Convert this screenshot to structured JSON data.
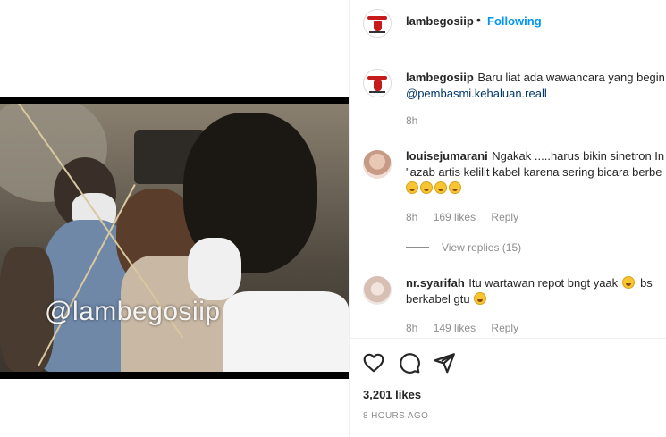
{
  "video": {
    "watermark": "@lambegosiip"
  },
  "header": {
    "username": "lambegosiip",
    "separator": "•",
    "follow_status": "Following"
  },
  "comments": [
    {
      "username": "lambegosiip",
      "text": "Baru liat ada wawancara yang begin",
      "text2": "@pembasmi.kehaluan.reall",
      "time": "8h"
    },
    {
      "username": "louisejumarani",
      "text": "Ngakak .....harus bikin sinetron In",
      "text2": "\"azab artis kelilit kabel karena sering bicara berbe",
      "emoji_count": 4,
      "time": "8h",
      "likes": "169 likes",
      "reply": "Reply",
      "view_replies": "View replies (15)"
    },
    {
      "username": "nr.syarifah",
      "text": "Itu wartawan repot bngt yaak",
      "text_after_emoji": "bs",
      "text2": "berkabel gtu",
      "time": "8h",
      "likes": "149 likes",
      "reply": "Reply"
    }
  ],
  "actions": {
    "icons": [
      "heart-icon",
      "comment-icon",
      "share-icon"
    ],
    "likes": "3,201 likes",
    "timestamp": "8 HOURS AGO"
  },
  "colors": {
    "link": "#00376b",
    "follow": "#0095f6",
    "muted": "#8e8e8e",
    "logo_red": "#c61b1b"
  }
}
